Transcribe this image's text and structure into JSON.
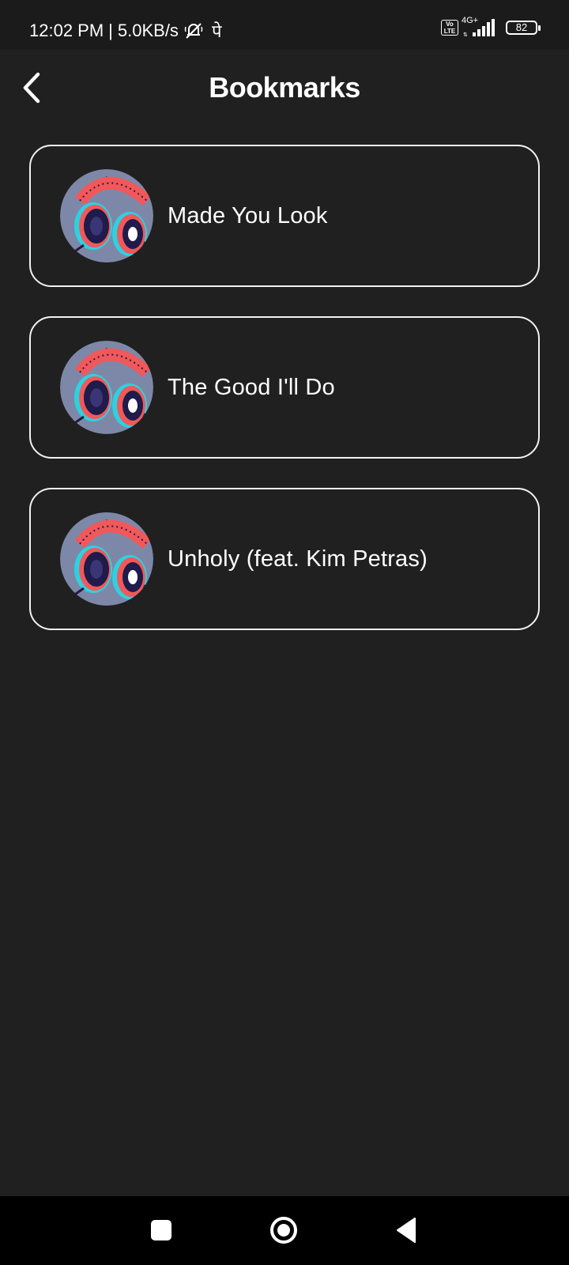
{
  "status_bar": {
    "time": "12:02 PM",
    "separator": "|",
    "net_speed": "5.0KB/s",
    "deva_char": "पे",
    "volte": "Vo\nLTE",
    "network": "4G+",
    "battery": "82"
  },
  "header": {
    "title": "Bookmarks",
    "back_icon": "chevron-left-icon"
  },
  "bookmarks": [
    {
      "title": "Made You Look",
      "icon": "headphones-artwork"
    },
    {
      "title": "The Good I'll Do",
      "icon": "headphones-artwork"
    },
    {
      "title": "Unholy (feat. Kim Petras)",
      "icon": "headphones-artwork"
    }
  ],
  "nav_bar": {
    "recent_icon": "square-icon",
    "home_icon": "circle-icon",
    "back_icon": "triangle-back-icon"
  },
  "colors": {
    "background": "#202020",
    "status_bar": "#1b1b1b",
    "nav_bar": "#000000",
    "card_border": "#f2f2f2",
    "artwork_bg": "#7d88a8",
    "headphone_red": "#f0585a",
    "headphone_cyan": "#2ed1e0",
    "headphone_navy": "#1f1b4a"
  }
}
